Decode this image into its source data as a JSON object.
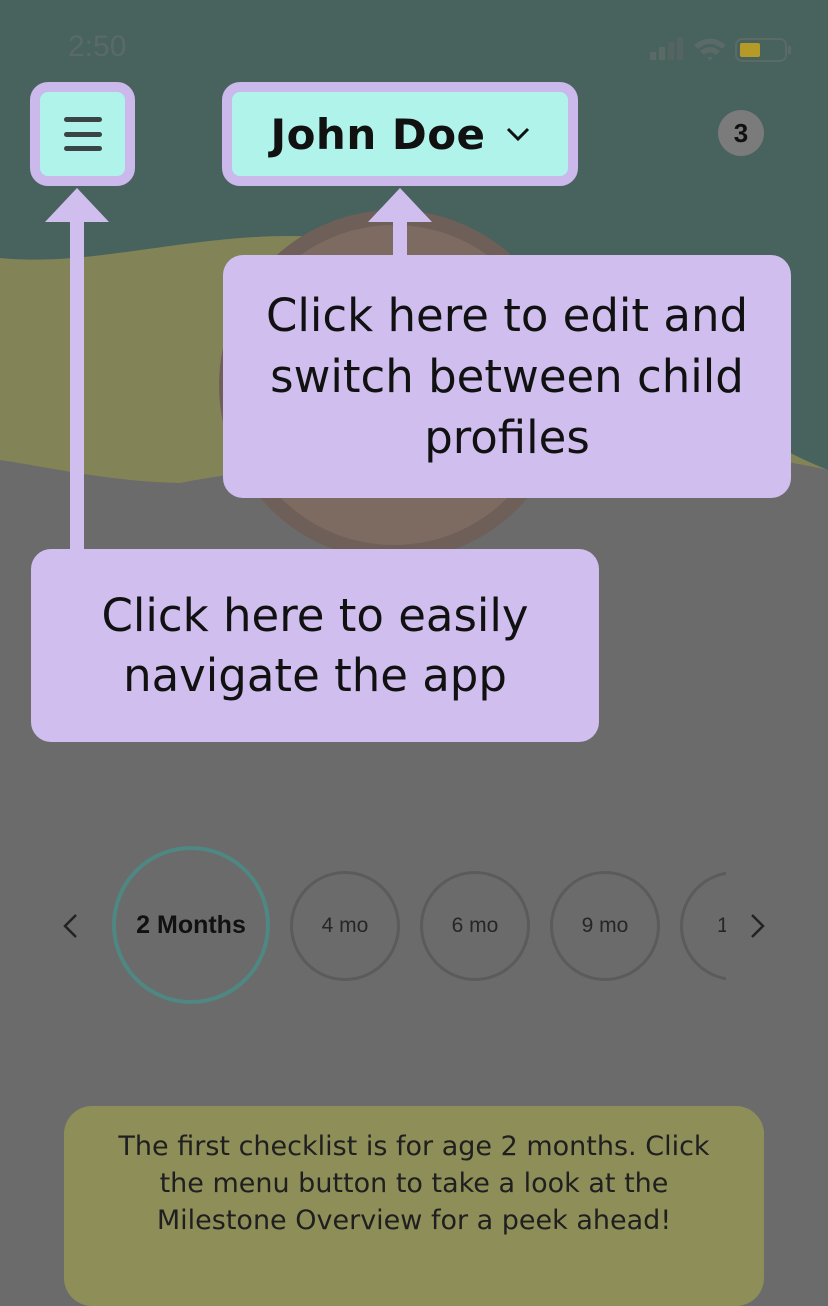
{
  "status_bar": {
    "time": "2:50"
  },
  "header": {
    "profile_name": "John Doe",
    "notification_count": "3"
  },
  "tooltips": {
    "profile": "Click here to edit and switch between child profiles",
    "menu": "Click here to easily navigate the app"
  },
  "age_selector": {
    "items": [
      "2 Months",
      "4 mo",
      "6 mo",
      "9 mo",
      "1"
    ],
    "selected": "2 Months"
  },
  "checklist_card": {
    "message": "The first checklist is for age 2 months. Click the menu button to take a look at the Milestone Overview for a peek ahead!"
  },
  "icons": {
    "menu": "hamburger-icon",
    "profile_dropdown": "chevron-down-icon",
    "prev": "chevron-left-icon",
    "next": "chevron-right-icon"
  },
  "colors": {
    "highlight_fill": "#aff3ea",
    "tooltip_fill": "#cfbeee",
    "active_ring": "#4f8782",
    "card_fill": "#8e8e59"
  }
}
